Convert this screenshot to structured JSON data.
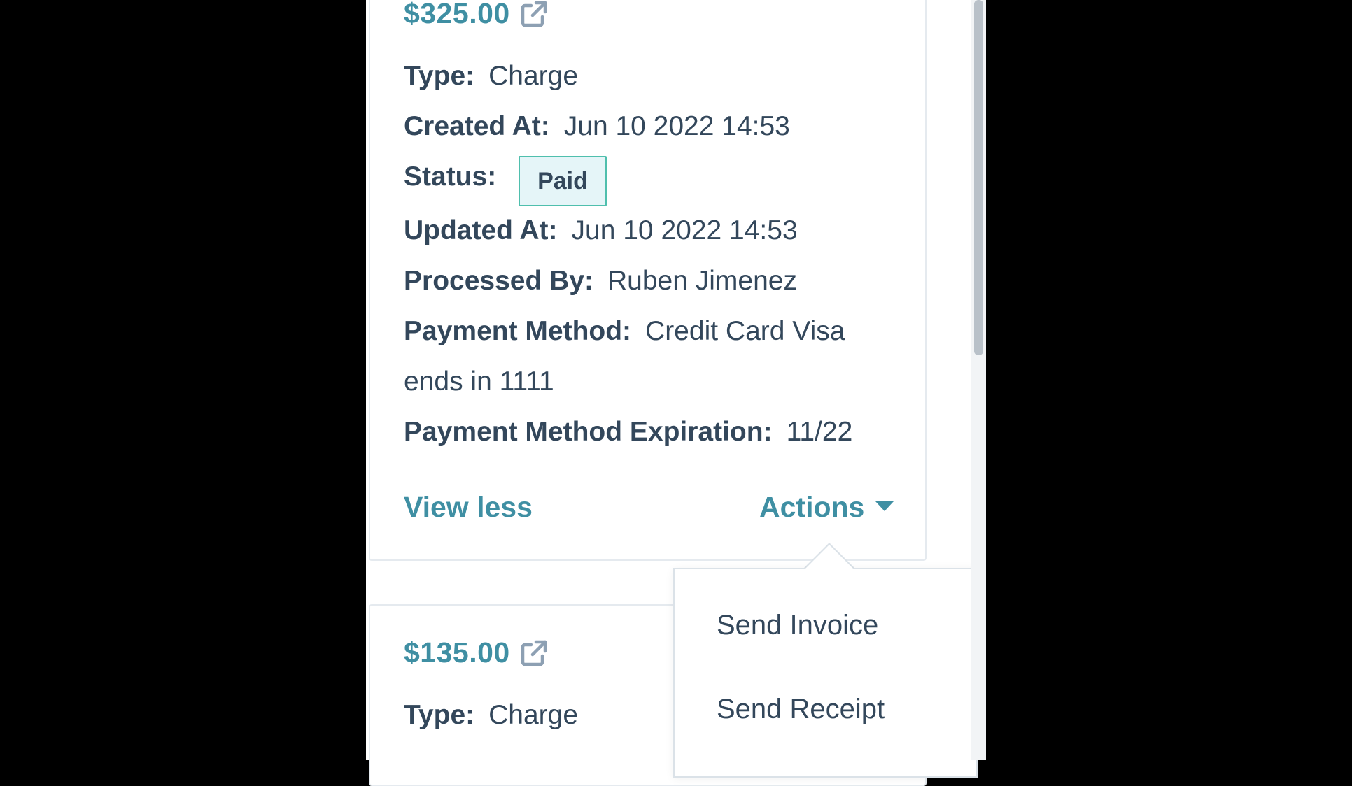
{
  "colors": {
    "link": "#3f8fa3",
    "text": "#33475b",
    "badge_border": "#4fbfad",
    "badge_bg": "#e5f5f8",
    "backdrop": "#000000"
  },
  "payments": [
    {
      "amount": "$325.00",
      "icon": "external-link-icon",
      "fields": {
        "type_label": "Type:",
        "type_value": "Charge",
        "created_label": "Created At:",
        "created_value": "Jun 10 2022 14:53",
        "status_label": "Status:",
        "status_value": "Paid",
        "updated_label": "Updated At:",
        "updated_value": "Jun 10 2022 14:53",
        "processed_label": "Processed By:",
        "processed_value": "Ruben Jimenez",
        "method_label": "Payment Method:",
        "method_value_line1": "Credit Card Visa",
        "method_value_line2": "ends in 1111",
        "expiration_label": "Payment Method Expiration:",
        "expiration_value": "11/22"
      },
      "view_less_label": "View less",
      "actions_label": "Actions"
    },
    {
      "amount": "$135.00",
      "icon": "external-link-icon",
      "fields": {
        "type_label": "Type:",
        "type_value": "Charge"
      }
    }
  ],
  "actions_menu": {
    "items": [
      "Send Invoice",
      "Send Receipt"
    ]
  }
}
